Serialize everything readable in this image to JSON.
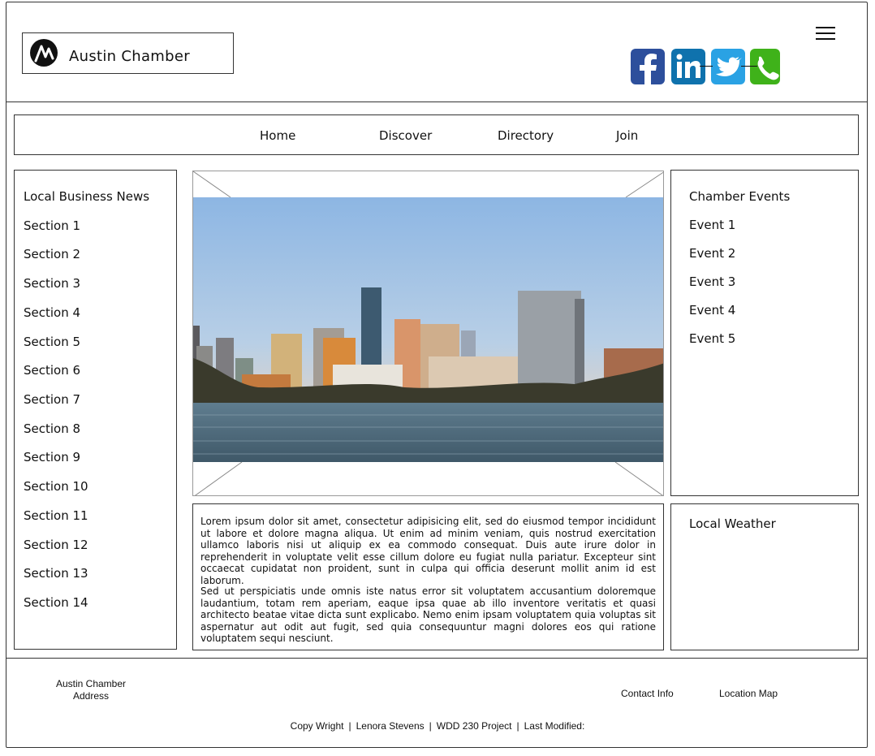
{
  "header": {
    "site_title": "Austin Chamber",
    "logo_icon": "chamber-logo-icon",
    "menu_icon": "hamburger-menu-icon",
    "social": [
      {
        "name": "facebook",
        "icon": "facebook-icon",
        "color": "#2d4f9c"
      },
      {
        "name": "linkedin",
        "icon": "linkedin-icon",
        "color": "#0f72ad"
      },
      {
        "name": "twitter",
        "icon": "twitter-icon",
        "color": "#2aa2e4"
      },
      {
        "name": "phone",
        "icon": "phone-icon",
        "color": "#3fb21a"
      }
    ]
  },
  "nav": {
    "items": [
      {
        "label": "Home"
      },
      {
        "label": "Discover"
      },
      {
        "label": "Directory"
      },
      {
        "label": "Join"
      }
    ]
  },
  "sidebar": {
    "heading": "Local Business News",
    "items": [
      {
        "label": "Section 1"
      },
      {
        "label": "Section 2"
      },
      {
        "label": "Section 3"
      },
      {
        "label": "Section 4"
      },
      {
        "label": "Section 5"
      },
      {
        "label": "Section 6"
      },
      {
        "label": "Section 7"
      },
      {
        "label": "Section 8"
      },
      {
        "label": "Section 9"
      },
      {
        "label": "Section 10"
      },
      {
        "label": "Section 11"
      },
      {
        "label": "Section 12"
      },
      {
        "label": "Section 13"
      },
      {
        "label": "Section 14"
      }
    ]
  },
  "hero": {
    "image": "austin-skyline-image"
  },
  "article": {
    "paragraphs": [
      "Lorem ipsum dolor sit amet, consectetur adipisicing elit, sed do eiusmod tempor incididunt ut labore et dolore magna aliqua. Ut enim ad minim veniam, quis nostrud exercitation ullamco laboris nisi ut aliquip ex ea commodo consequat. Duis aute irure dolor in reprehenderit in voluptate velit esse cillum dolore eu fugiat nulla pariatur. Excepteur sint occaecat cupidatat non proident, sunt in culpa qui officia deserunt mollit anim id est laborum.",
      "Sed ut perspiciatis unde omnis iste natus error sit voluptatem accusantium doloremque laudantium, totam rem aperiam, eaque ipsa quae ab illo inventore veritatis et quasi architecto beatae vitae dicta sunt explicabo. Nemo enim ipsam voluptatem quia voluptas sit aspernatur aut odit aut fugit, sed quia consequuntur magni dolores eos qui ratione voluptatem sequi nesciunt."
    ]
  },
  "events": {
    "heading": "Chamber Events",
    "items": [
      {
        "label": "Event 1"
      },
      {
        "label": "Event 2"
      },
      {
        "label": "Event 3"
      },
      {
        "label": "Event 4"
      },
      {
        "label": "Event 5"
      }
    ]
  },
  "weather": {
    "heading": "Local Weather"
  },
  "footer": {
    "address_line1": "Austin Chamber",
    "address_line2": "Address",
    "contact_label": "Contact Info",
    "map_label": "Location Map",
    "copyright": "Copy Wright",
    "author": "Lenora Stevens",
    "project": "WDD 230 Project",
    "modified": "Last Modified:",
    "separator": "|"
  }
}
